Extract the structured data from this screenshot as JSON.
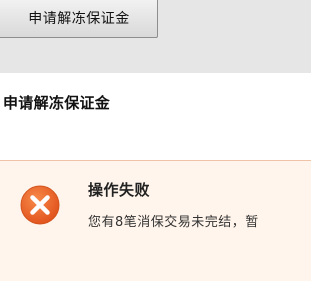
{
  "top_button": {
    "label": "申请解冻保证金"
  },
  "section": {
    "title": "申请解冻保证金"
  },
  "alert": {
    "type": "error",
    "icon": "error-x-circle-icon",
    "heading": "操作失败",
    "message": "您有8笔消保交易未完结，暂",
    "colors": {
      "icon": "#e8561e",
      "background": "#fff5ec",
      "border": "#f0c2a6"
    }
  }
}
